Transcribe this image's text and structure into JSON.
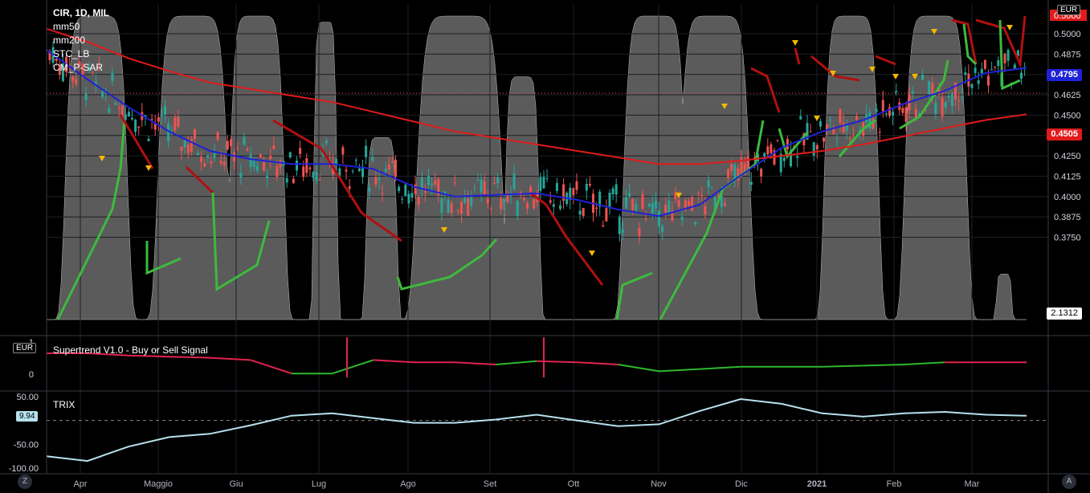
{
  "legend": {
    "ticker": "CIR, 1D, MIL",
    "indicators": [
      "mm50",
      "mm200",
      "STC_LB",
      "CM_P-SAR"
    ]
  },
  "currency": "EUR",
  "price_axis": {
    "ticks": [
      "0.5000",
      "0.4875",
      "0.4750",
      "0.4625",
      "0.4500",
      "0.4375",
      "0.4250",
      "0.4125",
      "0.4000",
      "0.3875",
      "0.3750"
    ],
    "tags": {
      "last": {
        "text": "0.4795",
        "color": "#1e22d6"
      },
      "mm200": {
        "text": "0.4505",
        "color": "#e01b1b"
      },
      "top": {
        "text": "0.5000",
        "color": "#e01b1b"
      },
      "stc": {
        "text": "2.1312",
        "color": "#ffffff"
      }
    }
  },
  "supertrend": {
    "title": "Supertrend V1.0 - Buy or Sell Signal",
    "axis_ticks": [
      "1",
      "0"
    ],
    "cur_label": "EUR"
  },
  "trix": {
    "title": "TRIX",
    "axis_ticks": [
      "50.00",
      "-50.00",
      "-100.00"
    ],
    "last": "9.94"
  },
  "time_axis": [
    "Apr",
    "Maggio",
    "Giu",
    "Lug",
    "Ago",
    "Set",
    "Ott",
    "Nov",
    "Dic",
    "2021",
    "Feb",
    "Mar"
  ],
  "corners": {
    "left": "Z",
    "right": "A"
  },
  "colors": {
    "up": "#26a69a",
    "down": "#ef5350",
    "mm50": "#1e22d6",
    "mm200": "#e01b1b",
    "stc": "#7a7a7a",
    "sar_bull": "#3dba3d",
    "sar_bear": "#b01010",
    "trix": "#b7e1ee"
  },
  "chart_data": [
    {
      "type": "line",
      "title": "CIR, 1D, MIL",
      "ylim": [
        0.3625,
        0.5063
      ],
      "x": [
        "Mar-20",
        "Apr",
        "Apr-15",
        "Maggio",
        "Maggio-15",
        "Giu",
        "Giu-15",
        "Lug",
        "Lug-15",
        "Ago",
        "Ago-15",
        "Set",
        "Set-15",
        "Ott",
        "Ott-15",
        "Nov",
        "Nov-15",
        "Dic",
        "Dic-15",
        "2021",
        "2021-15",
        "Feb",
        "Feb-15",
        "Mar",
        "Mar-15"
      ],
      "series": [
        {
          "name": "mm50",
          "values": [
            0.49,
            0.472,
            0.455,
            0.44,
            0.428,
            0.423,
            0.42,
            0.42,
            0.417,
            0.406,
            0.4,
            0.401,
            0.402,
            0.398,
            0.392,
            0.388,
            0.395,
            0.413,
            0.43,
            0.44,
            0.447,
            0.457,
            0.465,
            0.476,
            0.479
          ]
        },
        {
          "name": "mm200",
          "values": [
            0.503,
            0.495,
            0.485,
            0.477,
            0.47,
            0.466,
            0.462,
            0.458,
            0.452,
            0.446,
            0.44,
            0.436,
            0.432,
            0.428,
            0.424,
            0.42,
            0.42,
            0.422,
            0.425,
            0.428,
            0.432,
            0.437,
            0.442,
            0.447,
            0.4505
          ]
        }
      ]
    },
    {
      "type": "line",
      "title": "Supertrend V1.0 - Buy or Sell Signal",
      "x": [
        "Mar-20",
        "Apr",
        "Apr-15",
        "Maggio",
        "Maggio-15",
        "Giu",
        "Giu-15",
        "Lug",
        "Lug-15",
        "Ago",
        "Ago-15",
        "Set",
        "Set-15",
        "Ott",
        "Ott-15",
        "Nov",
        "Nov-15",
        "Dic",
        "Dic-15",
        "2021",
        "2021-15",
        "Feb",
        "Feb-15",
        "Mar",
        "Mar-15"
      ],
      "series": [
        {
          "name": "Supertrend",
          "values": [
            1,
            1,
            0.9,
            0.85,
            0.8,
            0.7,
            0.1,
            0.1,
            0.7,
            0.6,
            0.6,
            0.5,
            0.65,
            0.6,
            0.5,
            0.2,
            0.3,
            0.4,
            0.4,
            0.4,
            0.45,
            0.5,
            0.6,
            0.6,
            0.6
          ]
        }
      ]
    },
    {
      "type": "line",
      "title": "TRIX",
      "ylim": [
        -100,
        50
      ],
      "x": [
        "Mar-20",
        "Apr",
        "Apr-15",
        "Maggio",
        "Maggio-15",
        "Giu",
        "Giu-15",
        "Lug",
        "Lug-15",
        "Ago",
        "Ago-15",
        "Set",
        "Set-15",
        "Ott",
        "Ott-15",
        "Nov",
        "Nov-15",
        "Dic",
        "Dic-15",
        "2021",
        "2021-15",
        "Feb",
        "Feb-15",
        "Mar",
        "Mar-15"
      ],
      "series": [
        {
          "name": "TRIX",
          "values": [
            -75,
            -85,
            -55,
            -35,
            -28,
            -10,
            10,
            15,
            5,
            -5,
            -5,
            2,
            12,
            0,
            -12,
            -8,
            20,
            45,
            35,
            15,
            8,
            15,
            18,
            12,
            9.94
          ]
        }
      ]
    }
  ]
}
